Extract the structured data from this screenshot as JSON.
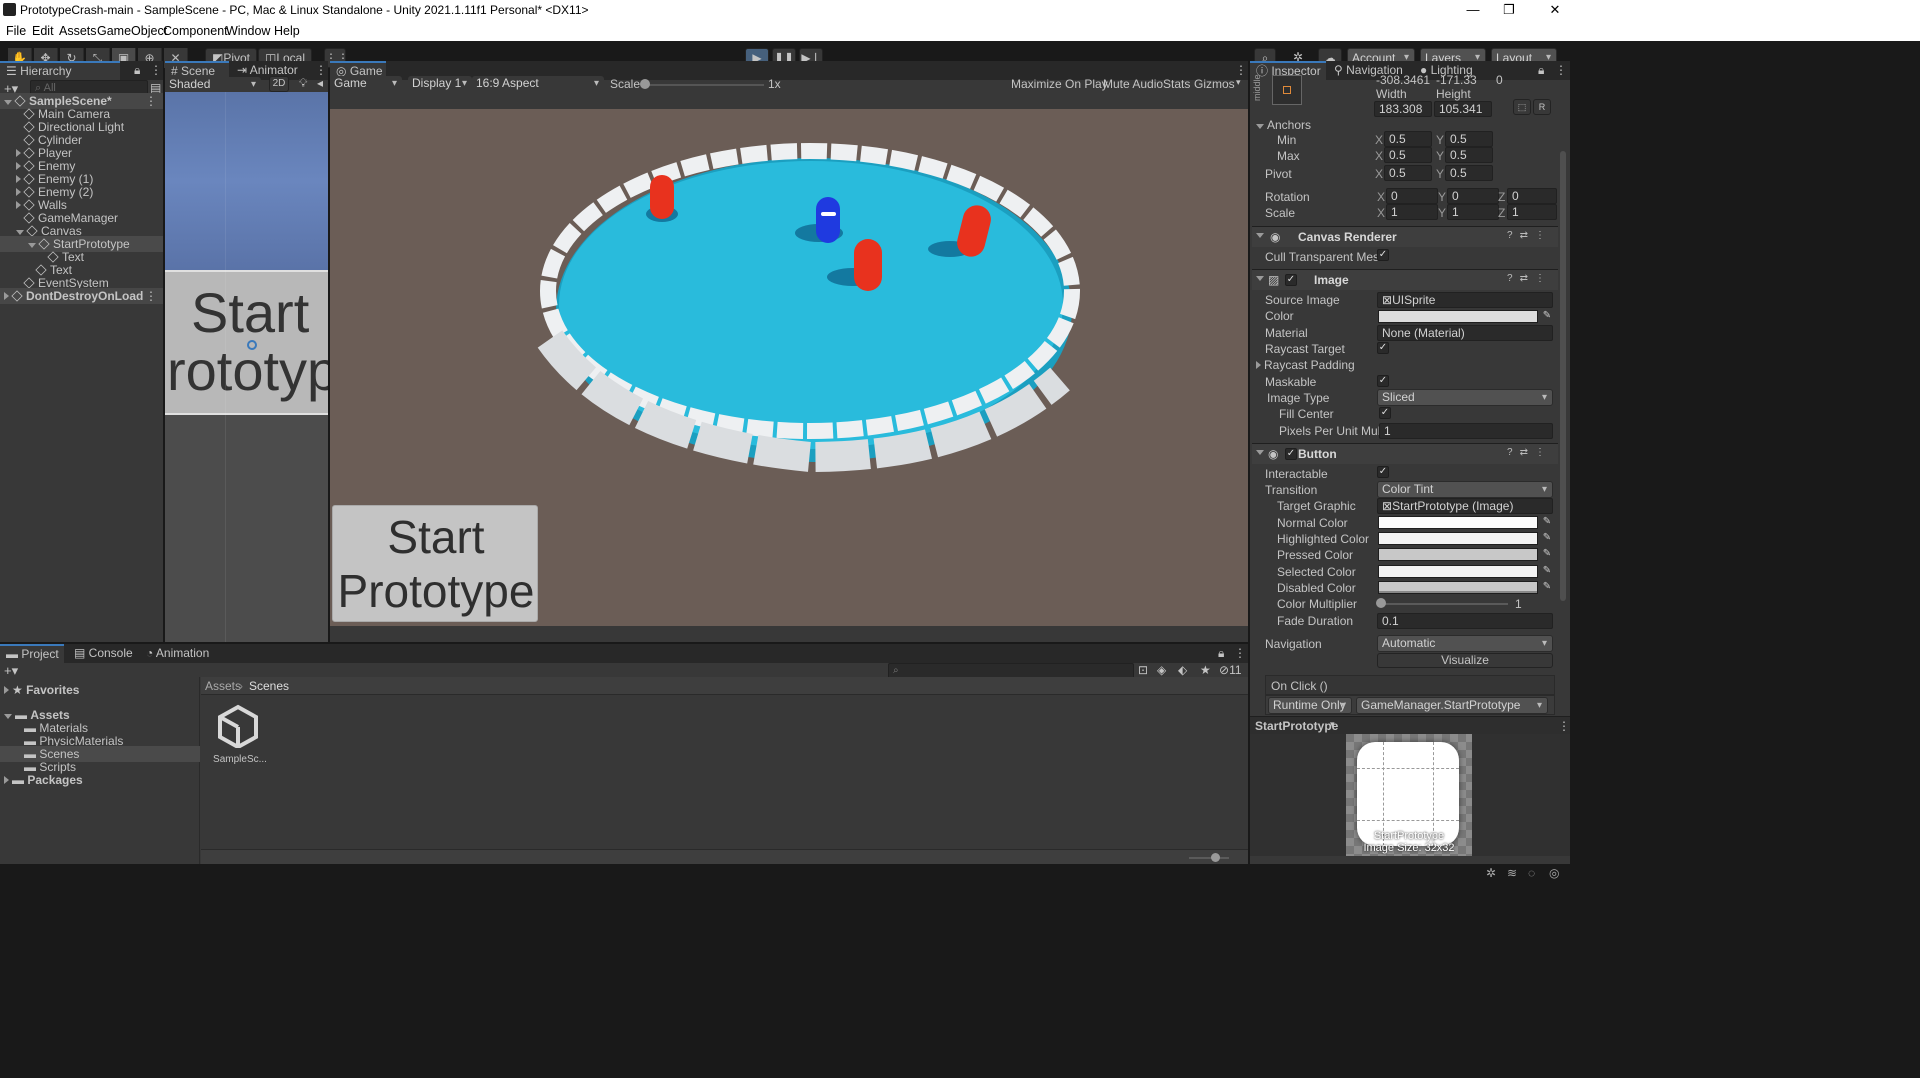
{
  "window": {
    "title": "PrototypeCrash-main - SampleScene - PC, Mac & Linux Standalone - Unity 2021.1.11f1 Personal* <DX11>",
    "controls": [
      "—",
      "❐",
      "✕"
    ]
  },
  "menu": [
    "File",
    "Edit",
    "Assets",
    "GameObject",
    "Component",
    "Window",
    "Help"
  ],
  "toolbar": {
    "pivot": "Pivot",
    "local": "Local",
    "account": "Account",
    "layers": "Layers",
    "layout": "Layout"
  },
  "hierarchy": {
    "tab": "Hierarchy",
    "search_placeholder": "All",
    "items": [
      {
        "label": "SampleScene*",
        "depth": 0,
        "expanded": true,
        "scene": true
      },
      {
        "label": "Main Camera",
        "depth": 1
      },
      {
        "label": "Directional Light",
        "depth": 1
      },
      {
        "label": "Cylinder",
        "depth": 1
      },
      {
        "label": "Player",
        "depth": 1,
        "collapsed": true
      },
      {
        "label": "Enemy",
        "depth": 1,
        "collapsed": true
      },
      {
        "label": "Enemy (1)",
        "depth": 1,
        "collapsed": true
      },
      {
        "label": "Enemy (2)",
        "depth": 1,
        "collapsed": true
      },
      {
        "label": "Walls",
        "depth": 1,
        "collapsed": true
      },
      {
        "label": "GameManager",
        "depth": 1
      },
      {
        "label": "Canvas",
        "depth": 1,
        "expanded": true
      },
      {
        "label": "StartPrototype",
        "depth": 2,
        "expanded": true,
        "selected": true
      },
      {
        "label": "Text",
        "depth": 3
      },
      {
        "label": "Text",
        "depth": 2
      },
      {
        "label": "EventSystem",
        "depth": 1
      },
      {
        "label": "DontDestroyOnLoad",
        "depth": 0,
        "collapsed": true,
        "scene": true
      }
    ]
  },
  "scene": {
    "tabs": [
      "Scene",
      "Animator"
    ],
    "shading": "Shaded",
    "mode_2d": "2D",
    "button_text_line1": "Start",
    "button_text_line2": "rototyp"
  },
  "game": {
    "tab": "Game",
    "display_mode": "Game",
    "display": "Display 1",
    "aspect": "16:9 Aspect",
    "scale_label": "Scale",
    "scale_value": "1x",
    "maximize": "Maximize On Play",
    "mute": "Mute Audio",
    "stats": "Stats",
    "gizmos": "Gizmos",
    "button_line1": "Start",
    "button_line2": "Prototype"
  },
  "inspector": {
    "tabs": [
      "Inspector",
      "Navigation",
      "Lighting"
    ],
    "pos": {
      "x": "-308.3461",
      "y": "-171.33",
      "z": "0"
    },
    "width_label": "Width",
    "height_label": "Height",
    "width": "183.308",
    "height": "105.341",
    "anchor_label_side": "middle",
    "anchors": "Anchors",
    "min": "Min",
    "max": "Max",
    "anchor_min": {
      "x": "0.5",
      "y": "0.5"
    },
    "anchor_max": {
      "x": "0.5",
      "y": "0.5"
    },
    "pivot": "Pivot",
    "pivot_v": {
      "x": "0.5",
      "y": "0.5"
    },
    "rotation": "Rotation",
    "rot": {
      "x": "0",
      "y": "0",
      "z": "0"
    },
    "scale": "Scale",
    "scl": {
      "x": "1",
      "y": "1",
      "z": "1"
    },
    "axis": {
      "x": "X",
      "y": "Y",
      "z": "Z"
    },
    "canvas_renderer": {
      "title": "Canvas Renderer",
      "cull": "Cull Transparent Mesh"
    },
    "image": {
      "title": "Image",
      "source_image_label": "Source Image",
      "source_image": "UISprite",
      "color_label": "Color",
      "material_label": "Material",
      "material": "None (Material)",
      "raycast_target": "Raycast Target",
      "raycast_padding": "Raycast Padding",
      "maskable": "Maskable",
      "image_type_label": "Image Type",
      "image_type": "Sliced",
      "fill_center": "Fill Center",
      "ppu_label": "Pixels Per Unit Multip",
      "ppu": "1"
    },
    "button": {
      "title": "Button",
      "interactable": "Interactable",
      "transition_label": "Transition",
      "transition": "Color Tint",
      "target_graphic_label": "Target Graphic",
      "target_graphic": "StartPrototype (Image)",
      "normal": "Normal Color",
      "highlighted": "Highlighted Color",
      "pressed": "Pressed Color",
      "selected": "Selected Color",
      "disabled": "Disabled Color",
      "multiplier_label": "Color Multiplier",
      "multiplier": "1",
      "fade_label": "Fade Duration",
      "fade": "0.1",
      "navigation_label": "Navigation",
      "navigation": "Automatic",
      "visualize": "Visualize",
      "onclick": "On Click ()",
      "runtime": "Runtime Only",
      "handler": "GameManager.StartPrototype"
    },
    "preview": {
      "title": "StartPrototype",
      "name": "StartPrototype",
      "size": "Image Size: 32x32"
    }
  },
  "project": {
    "tabs": [
      "Project",
      "Console",
      "Animation"
    ],
    "hidden_count": "11",
    "tree": [
      {
        "label": "Favorites",
        "bold": true,
        "depth": 0
      },
      {
        "label": "Assets",
        "bold": true,
        "depth": 0
      },
      {
        "label": "Materials",
        "depth": 1
      },
      {
        "label": "PhysicMaterials",
        "depth": 1
      },
      {
        "label": "Scenes",
        "depth": 1,
        "selected": true
      },
      {
        "label": "Scripts",
        "depth": 1
      },
      {
        "label": "Packages",
        "bold": true,
        "depth": 0
      }
    ],
    "breadcrumb": [
      "Assets",
      "Scenes"
    ],
    "asset": "SampleSc..."
  },
  "colors": {
    "accent": "#3a79bb",
    "panel": "#383838",
    "bg": "#191919",
    "arena": "#29bbdc",
    "ground": "#6b5d56",
    "enemy": "#e8321e",
    "player": "#1f3ae0"
  }
}
